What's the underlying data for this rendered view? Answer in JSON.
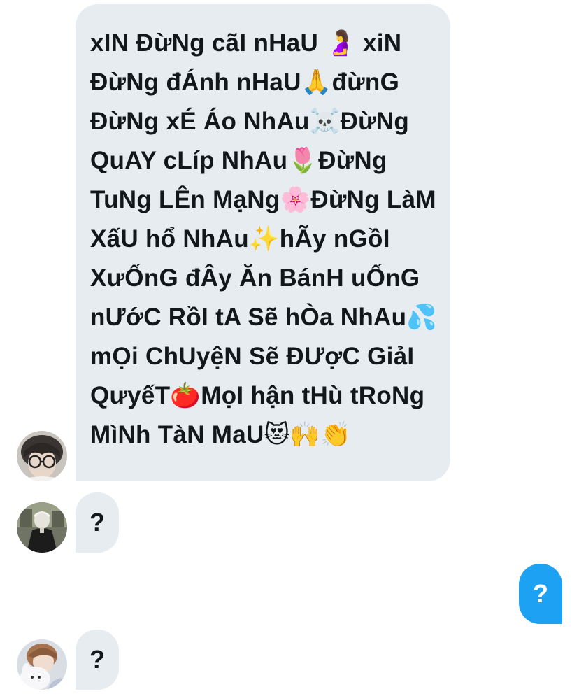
{
  "conversation": {
    "messages": [
      {
        "sender": "incoming",
        "text": "xIN ĐừNg cãI nHaU 🤰 xiN ĐừNg đÁnh nHaU🙏đừnG ĐừNg xÉ Áo NhAu☠️ĐừNg QuAY cLíp NhAu🌷ĐừNg TuNg LÊn MạNg🌸ĐừNg LàM XấU hổ NhAu✨hÃy nGồI XưỐnG đÂy Ăn BánH uỐnG nƯớC RồI tA Sẽ hÒa NhAu💦mỌi ChUyệN Sẽ ĐƯợC GiảI QưyếT🍅MọI hận tHù tRoNg MìNh TàN MaU😻🙌👏"
      },
      {
        "sender": "incoming",
        "text": "?"
      },
      {
        "sender": "outgoing",
        "text": "?"
      },
      {
        "sender": "incoming",
        "text": "?"
      }
    ]
  },
  "colors": {
    "incoming_bubble": "#e6ecf0",
    "outgoing_bubble": "#1da1f2",
    "text": "#14171a"
  },
  "avatars": [
    "avatar-glasses-user",
    "avatar-coat-user",
    "avatar-plush-user"
  ]
}
